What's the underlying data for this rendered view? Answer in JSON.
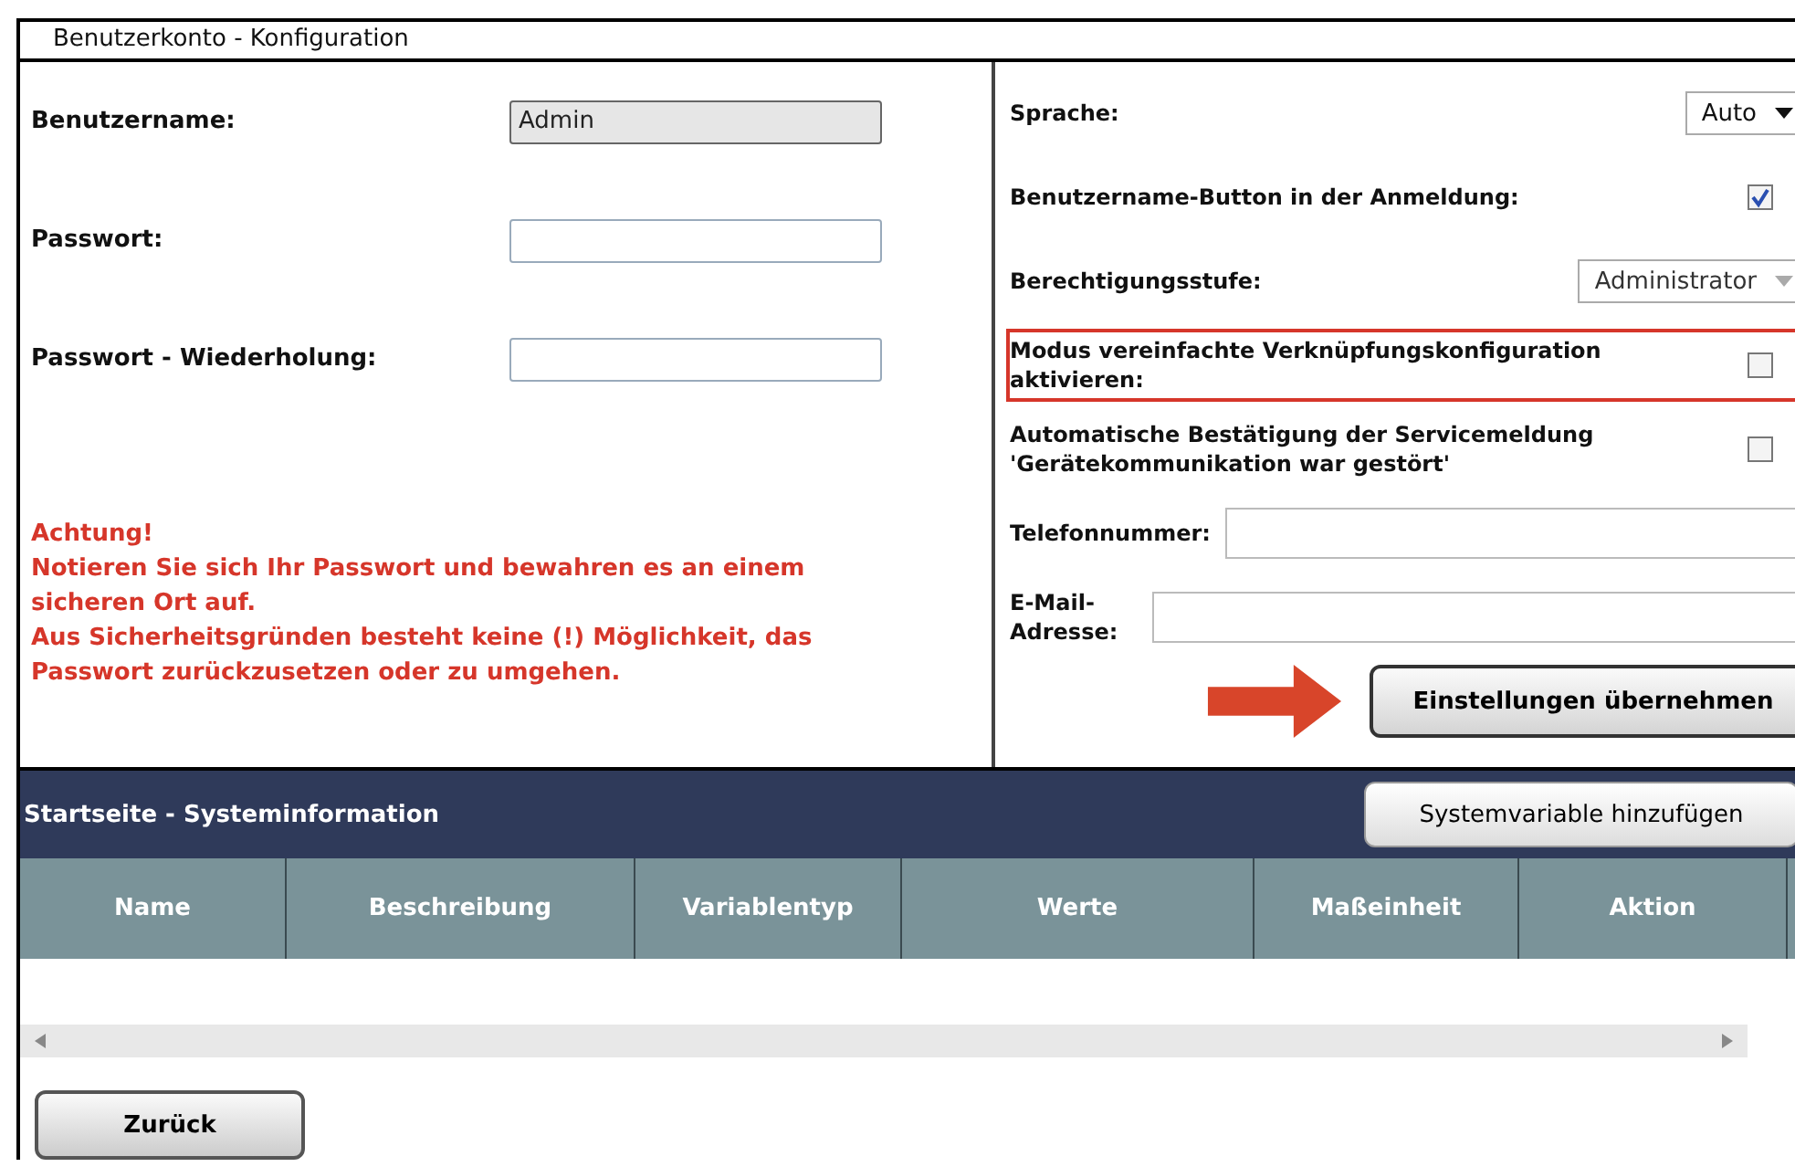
{
  "window": {
    "title": "Benutzerkonto - Konfiguration"
  },
  "account": [
    {
      "label": "Benutzername:",
      "value": "Admin",
      "disabled": true
    },
    {
      "label": "Passwort:",
      "disabled": false
    },
    {
      "label": "Passwort - Wiederholung:",
      "disabled": false
    }
  ],
  "warning": [
    "Achtung!",
    "Notieren Sie sich Ihr Passwort und bewahren es an einem sicheren Ort auf.",
    "Aus Sicherheitsgründen besteht keine (!) Möglichkeit, das Passwort zurückzusetzen oder zu umgehen."
  ],
  "settings": [
    {
      "kind": "select",
      "label": "Sprache:",
      "value": "Auto",
      "disabled": false,
      "highlighted": false
    },
    {
      "kind": "checkbox",
      "label": "Benutzername-Button in der Anmeldung:",
      "checked": true,
      "highlighted": false
    },
    {
      "kind": "select",
      "label": "Berechtigungsstufe:",
      "value": "Administrator",
      "disabled": true,
      "highlighted": false
    },
    {
      "kind": "checkbox",
      "label": "Modus vereinfachte Verknüpfungskonfiguration aktivieren:",
      "checked": false,
      "highlighted": true
    },
    {
      "kind": "checkbox",
      "label": "Automatische Bestätigung der Servicemeldung 'Gerätekommunikation war gestört'",
      "checked": false,
      "highlighted": false
    },
    {
      "kind": "input",
      "label": "Telefonnummer:",
      "highlighted": false
    },
    {
      "kind": "input",
      "label": "E-Mail-Adresse:",
      "highlighted": false
    }
  ],
  "apply_button": "Einstellungen übernehmen",
  "system": {
    "title": "Startseite - Systeminformation",
    "add_button": "Systemvariable hinzufügen",
    "columns": [
      "Name",
      "Beschreibung",
      "Variablentyp",
      "Werte",
      "Maßeinheit",
      "Aktion"
    ]
  },
  "back_button": "Zurück"
}
